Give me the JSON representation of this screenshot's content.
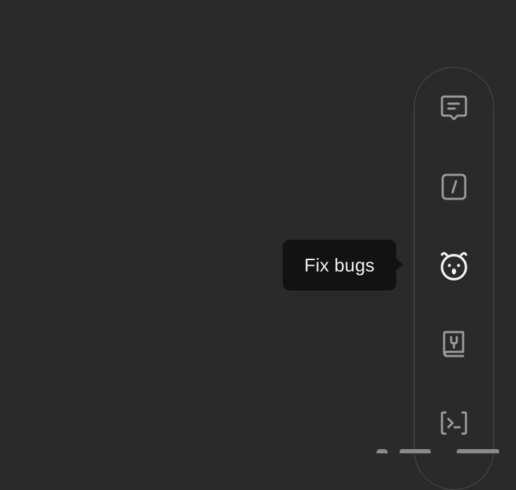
{
  "colors": {
    "background": "#2a2a2a",
    "toolbar_border": "#4b4b4b",
    "icon_inactive": "#9c9c9c",
    "icon_active": "#f2f2f2",
    "tooltip_background": "#121212",
    "tooltip_text": "#f1f1f1"
  },
  "toolbar": {
    "items": [
      {
        "icon": "message-icon",
        "active": false
      },
      {
        "icon": "slash-command-icon",
        "active": false
      },
      {
        "icon": "bug-icon",
        "active": true
      },
      {
        "icon": "book-icon",
        "active": false
      },
      {
        "icon": "terminal-icon",
        "active": false
      }
    ]
  },
  "tooltip": {
    "label": "Fix bugs"
  }
}
